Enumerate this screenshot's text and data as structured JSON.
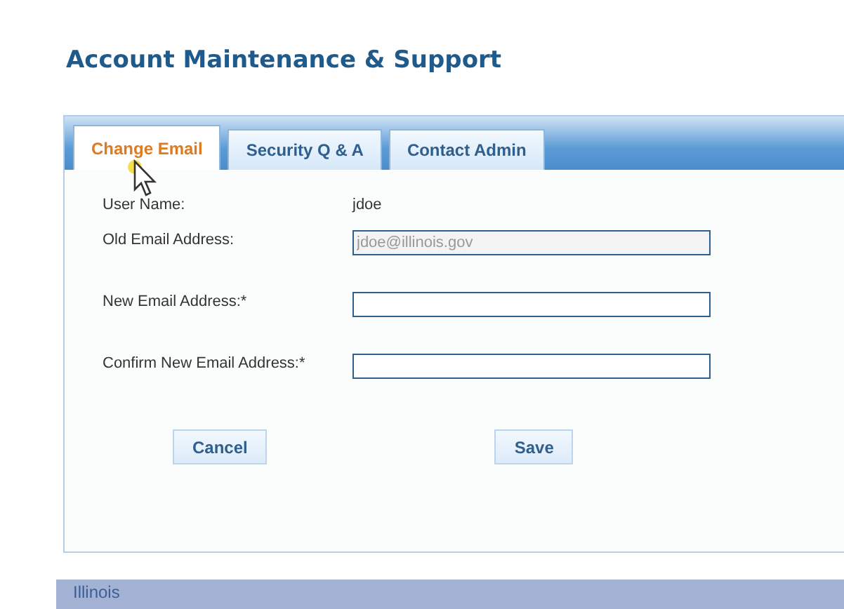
{
  "page_title": "Account Maintenance & Support",
  "tabs": [
    {
      "label": "Change Email",
      "selected": true
    },
    {
      "label": "Security Q & A",
      "selected": false
    },
    {
      "label": "Contact Admin",
      "selected": false
    }
  ],
  "fields": [
    {
      "kind": "text",
      "label": "User Name:",
      "value": "jdoe"
    },
    {
      "kind": "input",
      "label": "Old Email Address:",
      "value": "jdoe@illinois.gov",
      "disabled": true
    },
    {
      "kind": "input",
      "label": "New Email Address:*",
      "disabled": false
    },
    {
      "kind": "input",
      "label": "Confirm New Email Address:*",
      "disabled": false
    }
  ],
  "buttons": [
    "Cancel",
    "Save"
  ],
  "footer": {
    "text": "Illinois"
  }
}
